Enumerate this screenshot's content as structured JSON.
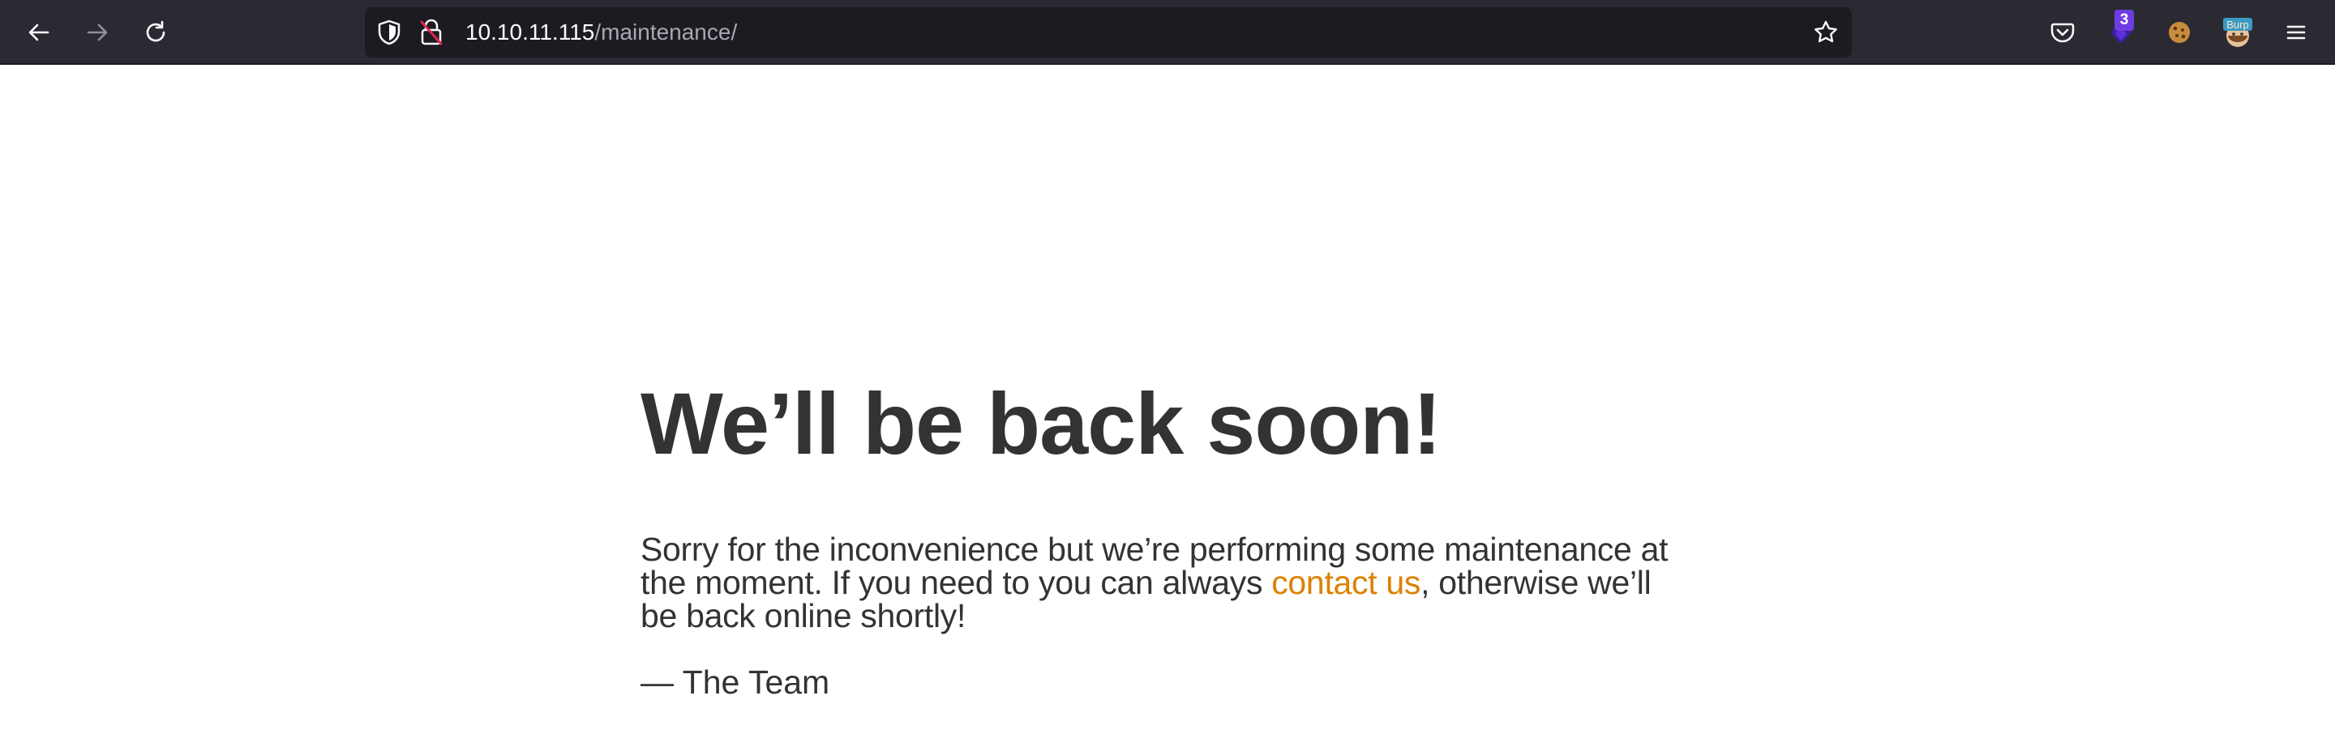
{
  "browser": {
    "url_host": "10.10.11.115",
    "url_path": "/maintenance/",
    "extension_badge_count": "3",
    "icons": {
      "back": "back-arrow-icon",
      "forward": "forward-arrow-icon",
      "reload": "reload-icon",
      "tracking_protection": "shield-icon",
      "connection": "insecure-lock-icon",
      "bookmark": "star-icon",
      "pocket": "pocket-icon",
      "extension": "extension-icon",
      "cookie": "cookie-icon",
      "burp": "burp-icon",
      "menu": "hamburger-menu-icon"
    },
    "burp_icon_label": "Burp"
  },
  "page": {
    "heading": "We’ll be back soon!",
    "message_before_link": "Sorry for the inconvenience but we’re performing some maintenance at the moment. If you need to you can always ",
    "link_text": "contact us",
    "message_after_link": ", otherwise we’ll be back online shortly!",
    "signature": "— The Team"
  },
  "colors": {
    "toolbar_bg": "#2b2a33",
    "urlbar_bg": "#1c1b22",
    "text": "#333333",
    "link": "#dc8100"
  }
}
